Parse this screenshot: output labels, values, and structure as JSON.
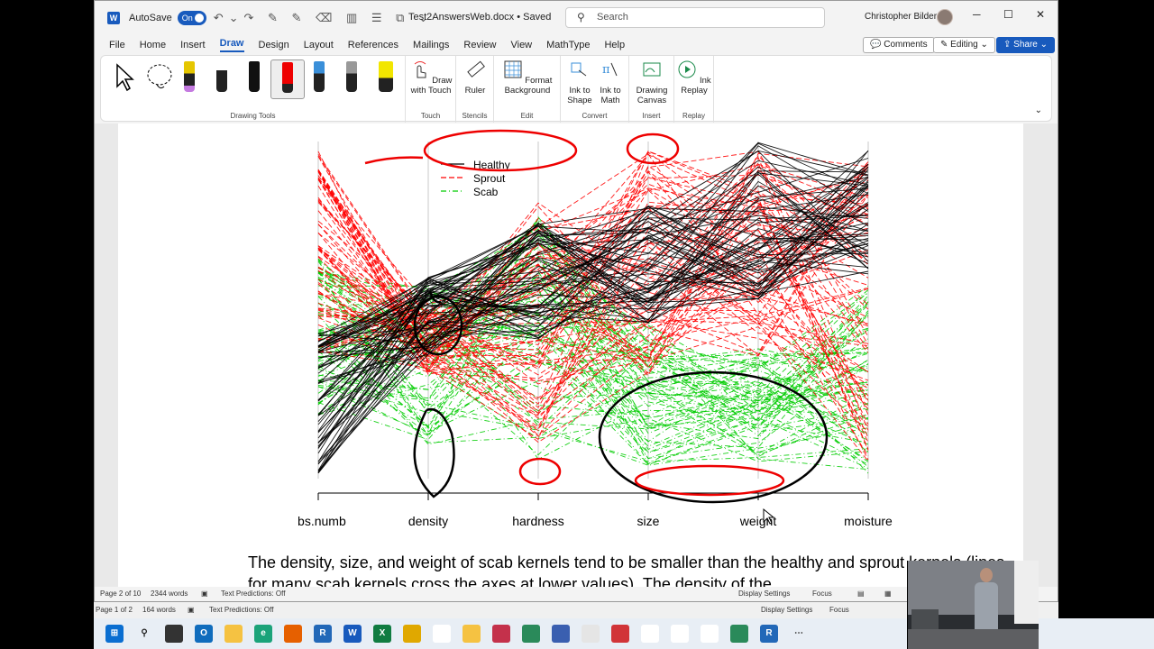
{
  "titlebar": {
    "autosave_label": "AutoSave",
    "autosave_state": "On",
    "document_title": "Test2AnswersWeb.docx • Saved",
    "search_placeholder": "Search",
    "user_name": "Christopher Bilder"
  },
  "menu": {
    "items": [
      "File",
      "Home",
      "Insert",
      "Draw",
      "Design",
      "Layout",
      "References",
      "Mailings",
      "Review",
      "View",
      "MathType",
      "Help"
    ],
    "active": "Draw",
    "comments_label": "Comments",
    "editing_label": "Editing",
    "share_label": "Share"
  },
  "ribbon": {
    "drawing_tools_label": "Drawing Tools",
    "draw_with_touch": "Draw with Touch",
    "touch_group": "Touch",
    "ruler": "Ruler",
    "stencils_group": "Stencils",
    "format_background": "Format Background",
    "edit_group": "Edit",
    "ink_to_shape": "Ink to Shape",
    "ink_to_math": "Ink to Math",
    "convert_group": "Convert",
    "drawing_canvas": "Drawing Canvas",
    "insert_group": "Insert",
    "ink_replay": "Ink Replay",
    "replay_group": "Replay"
  },
  "chart": {
    "legend": [
      "Healthy",
      "Sprout",
      "Scab"
    ],
    "axes": [
      "obs.numb",
      "density",
      "hardness",
      "size",
      "weight",
      "moisture"
    ],
    "colors": {
      "healthy": "#000000",
      "sprout": "#ff0000",
      "scab": "#00cc00"
    }
  },
  "chart_data": {
    "type": "parallel-coordinates",
    "axes": [
      "obs.numb",
      "density",
      "hardness",
      "size",
      "weight",
      "moisture"
    ],
    "series": [
      {
        "name": "Healthy",
        "color": "#000000",
        "line": "solid"
      },
      {
        "name": "Sprout",
        "color": "#ff0000",
        "line": "dashed"
      },
      {
        "name": "Scab",
        "color": "#00cc00",
        "line": "dot-dash"
      }
    ]
  },
  "document": {
    "paragraph": "The density, size, and weight of scab kernels tend to be smaller than the healthy and sprout kernels (lines for many scab kernels cross the axes at lower values). The density of the"
  },
  "status": {
    "page": "Page 2 of 10",
    "words": "2344 words",
    "text_predictions": "Text Predictions: Off",
    "display_settings": "Display Settings",
    "focus": "Focus"
  },
  "status_background": {
    "page": "Page 1 of 2",
    "words": "164 words",
    "text_predictions": "Text Predictions: Off",
    "display_settings": "Display Settings",
    "focus": "Focus"
  }
}
